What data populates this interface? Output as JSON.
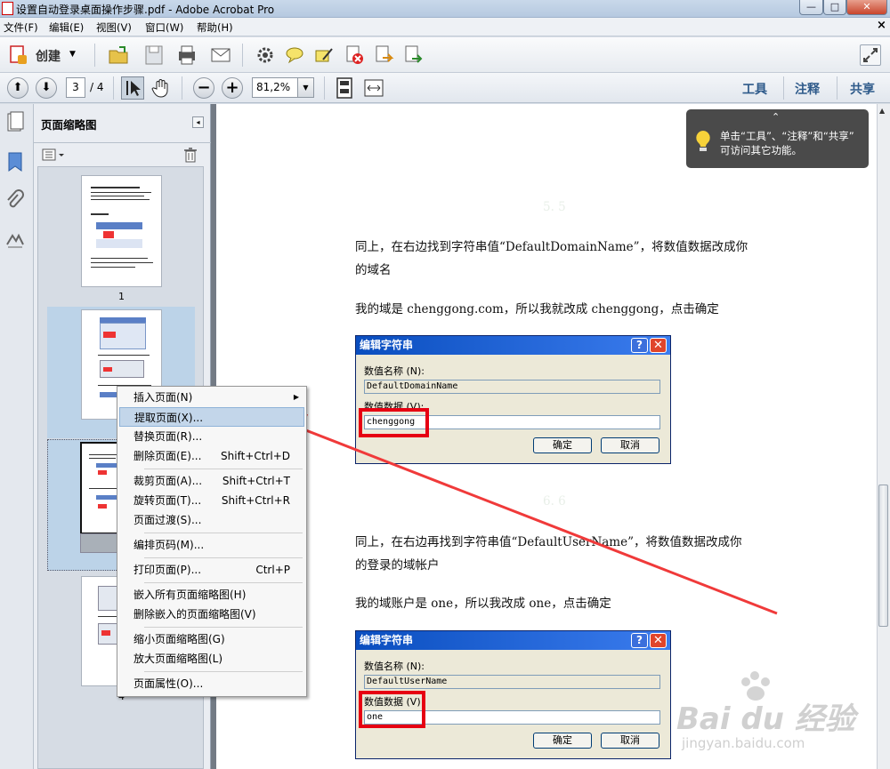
{
  "window": {
    "title": "设置自动登录桌面操作步骤.pdf - Adobe Acrobat Pro",
    "minimize": "—",
    "maximize": "□",
    "close": "✕"
  },
  "menu": {
    "file": "文件(F)",
    "edit": "编辑(E)",
    "view": "视图(V)",
    "window": "窗口(W)",
    "help": "帮助(H)",
    "close_doc": "×"
  },
  "toolbar": {
    "create_label": "创建",
    "page_current": "3",
    "page_total": "/ 4",
    "zoom": "81,2%",
    "tools": "工具",
    "comment": "注释",
    "share": "共享"
  },
  "panel": {
    "title": "页面缩略图",
    "thumb_labels": [
      "1",
      "4"
    ]
  },
  "document": {
    "step_faint_1": "5. 5",
    "para1_line1": "同上，在右边找到字符串值“DefaultDomainName”，将数值数据改成你",
    "para1_line2": "的域名",
    "para2": "我的域是 chenggong.com，所以我就改成 chenggong，点击确定",
    "step_faint_2": "6. 6",
    "para3_line1": "同上，在右边再找到字符串值“DefaultUserName”，将数值数据改成你",
    "para3_line2": "的登录的域帐户",
    "para4": "我的域账户是 one，所以我改成 one，点击确定"
  },
  "dialog1": {
    "title": "编辑字符串",
    "help": "?",
    "close": "✕",
    "name_label": "数值名称 (N):",
    "name_value": "DefaultDomainName",
    "data_label": "数值数据 (V):",
    "data_value": "chenggong",
    "ok": "确定",
    "cancel": "取消"
  },
  "dialog2": {
    "title": "编辑字符串",
    "help": "?",
    "close": "✕",
    "name_label": "数值名称 (N):",
    "name_value": "DefaultUserName",
    "data_label": "数值数据 (V)",
    "data_value": "one",
    "ok": "确定",
    "cancel": "取消"
  },
  "tooltip": {
    "line1": "单击“工具”、“注释”和“共享”",
    "line2": "可访问其它功能。"
  },
  "context_menu": {
    "items": [
      {
        "label": "插入页面(N)",
        "shortcut": "",
        "submenu": "▶"
      },
      {
        "label": "提取页面(X)...",
        "shortcut": ""
      },
      {
        "label": "替换页面(R)...",
        "shortcut": ""
      },
      {
        "label": "删除页面(E)...",
        "shortcut": "Shift+Ctrl+D"
      },
      {
        "label": "裁剪页面(A)...",
        "shortcut": "Shift+Ctrl+T"
      },
      {
        "label": "旋转页面(T)...",
        "shortcut": "Shift+Ctrl+R"
      },
      {
        "label": "页面过渡(S)...",
        "shortcut": ""
      },
      {
        "label": "编排页码(M)...",
        "shortcut": ""
      },
      {
        "label": "打印页面(P)...",
        "shortcut": "Ctrl+P"
      },
      {
        "label": "嵌入所有页面缩略图(H)",
        "shortcut": ""
      },
      {
        "label": "删除嵌入的页面缩略图(V)",
        "shortcut": ""
      },
      {
        "label": "缩小页面缩略图(G)",
        "shortcut": ""
      },
      {
        "label": "放大页面缩略图(L)",
        "shortcut": ""
      },
      {
        "label": "页面属性(O)...",
        "shortcut": ""
      }
    ]
  },
  "watermark": {
    "brand": "Bai du 经验",
    "url": "jingyan.baidu.com"
  },
  "colors": {
    "highlight_red": "#e60012",
    "arrow_red": "#f03a3a",
    "dialog_title_blue": "#0a4ebf",
    "right_button_text": "#2e5a8a"
  }
}
